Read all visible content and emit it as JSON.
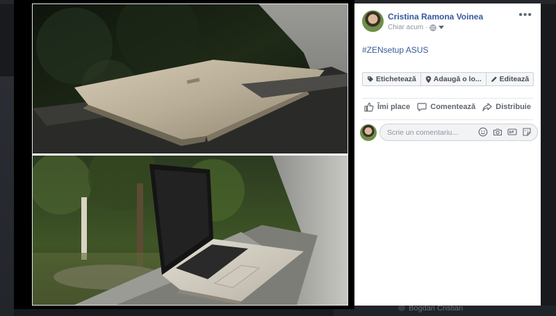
{
  "post": {
    "author": "Cristina Ramona Voinea",
    "timestamp": "Chiar acum",
    "separator": "·",
    "audience_icon": "globe-icon",
    "text": "#ZENsetup ASUS"
  },
  "photo_actions": {
    "tag": "Etichetează",
    "location": "Adaugă o lo...",
    "edit": "Editează"
  },
  "reactions": {
    "like": "Îmi place",
    "comment": "Comentează",
    "share": "Distribuie"
  },
  "comment": {
    "placeholder": "Scrie un comentariu..."
  },
  "background": {
    "ghost_name": "Bogdan Cristian"
  },
  "colors": {
    "link": "#365899",
    "muted": "#90949c",
    "panel": "#ffffff",
    "overlay": "#000000"
  }
}
